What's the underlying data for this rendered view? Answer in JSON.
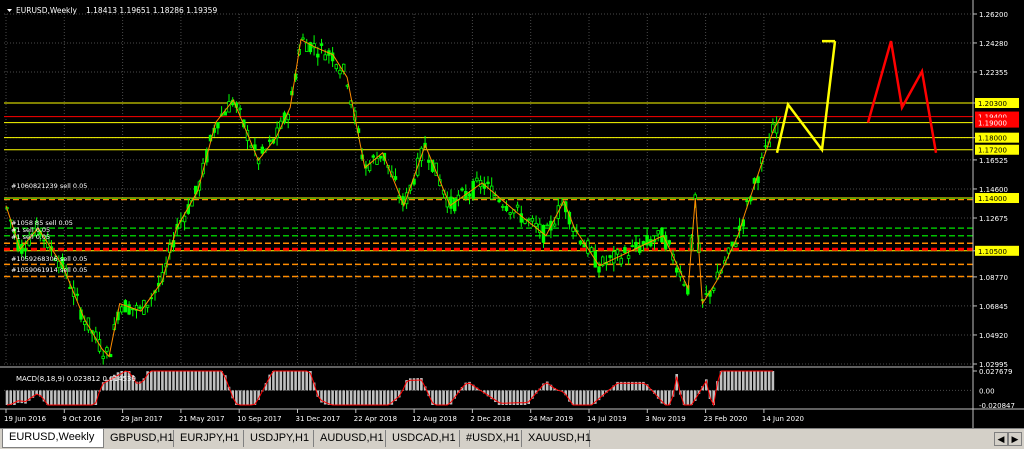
{
  "header": {
    "title": "EURUSD,Weekly",
    "ohlc": "1.18413 1.19651 1.18286 1.19359"
  },
  "price_axis": {
    "ticks": [
      "1.26200",
      "1.24280",
      "1.22355",
      "1.20300",
      "1.18000",
      "1.16525",
      "1.14600",
      "1.12675",
      "1.10500",
      "1.08770",
      "1.06845",
      "1.04920",
      "1.02995"
    ],
    "highlight_labels": [
      {
        "text": "1.20300",
        "bg": "#ffff00",
        "fg": "#000000"
      },
      {
        "text": "1.19400",
        "bg": "#ff0000",
        "fg": "#ffffff"
      },
      {
        "text": "1.19000",
        "bg": "#ff0000",
        "fg": "#ffffff"
      },
      {
        "text": "1.18000",
        "bg": "#ffff00",
        "fg": "#000000"
      },
      {
        "text": "1.17200",
        "bg": "#ffff00",
        "fg": "#000000"
      },
      {
        "text": "1.14000",
        "bg": "#ffff00",
        "fg": "#000000"
      },
      {
        "text": "1.10500",
        "bg": "#ffff00",
        "fg": "#000000"
      }
    ]
  },
  "time_axis": {
    "labels": [
      "19 Jun 2016",
      "9 Oct 2016",
      "29 Jan 2017",
      "21 May 2017",
      "10 Sep 2017",
      "31 Dec 2017",
      "22 Apr 2018",
      "12 Aug 2018",
      "2 Dec 2018",
      "24 Mar 2019",
      "14 Jul 2019",
      "3 Nov 2019",
      "23 Feb 2020",
      "14 Jun 2020"
    ]
  },
  "order_labels": [
    "#1060821239 sell 0.05",
    "#1058 85 sell 0.05",
    "#1 sell 0.05",
    "#1 sell 0.05",
    "#1059268306 sell 0.05",
    "#1059061914 sell 0.05"
  ],
  "macd": {
    "label": "MACD(8,18,9) 0.023812 0.014539",
    "ticks": [
      "0.027679",
      "0.00",
      "-0.020847"
    ]
  },
  "tabs": [
    {
      "label": "EURUSD,Weekly",
      "active": true
    },
    {
      "label": "GBPUSD,H1"
    },
    {
      "label": "EURJPY,H1"
    },
    {
      "label": "USDJPY,H1"
    },
    {
      "label": "AUDUSD,H1"
    },
    {
      "label": "USDCAD,H1"
    },
    {
      "label": "#USDX,H1"
    },
    {
      "label": "XAUUSD,H1"
    }
  ],
  "colors": {
    "background": "#000000",
    "grid": "#4a4a4a",
    "bull_candle": "#00ff00",
    "level_yellow": "#ffff00",
    "level_red": "#ff0000",
    "zigzag": "#ff8c00",
    "projection_bull": "#ffff00",
    "projection_bear": "#ff0000",
    "text": "#ffffff"
  },
  "chart_data": {
    "type": "candlestick",
    "symbol": "EURUSD",
    "timeframe": "Weekly",
    "ylim": [
      1.02995,
      1.262
    ],
    "close_path": [
      [
        "2016-06-19",
        1.135
      ],
      [
        "2016-07-17",
        1.106
      ],
      [
        "2016-08-21",
        1.12
      ],
      [
        "2016-10-09",
        1.095
      ],
      [
        "2016-11-20",
        1.06
      ],
      [
        "2016-12-25",
        1.04
      ],
      [
        "2017-01-08",
        1.035
      ],
      [
        "2017-01-29",
        1.07
      ],
      [
        "2017-03-12",
        1.065
      ],
      [
        "2017-04-23",
        1.085
      ],
      [
        "2017-05-21",
        1.12
      ],
      [
        "2017-07-02",
        1.145
      ],
      [
        "2017-08-06",
        1.19
      ],
      [
        "2017-09-10",
        1.205
      ],
      [
        "2017-10-29",
        1.165
      ],
      [
        "2017-12-03",
        1.18
      ],
      [
        "2017-12-31",
        1.2
      ],
      [
        "2018-01-21",
        1.245
      ],
      [
        "2018-02-18",
        1.24
      ],
      [
        "2018-03-25",
        1.235
      ],
      [
        "2018-04-22",
        1.22
      ],
      [
        "2018-05-27",
        1.16
      ],
      [
        "2018-07-01",
        1.17
      ],
      [
        "2018-08-12",
        1.135
      ],
      [
        "2018-09-23",
        1.175
      ],
      [
        "2018-11-11",
        1.135
      ],
      [
        "2018-12-02",
        1.14
      ],
      [
        "2019-01-13",
        1.15
      ],
      [
        "2019-03-24",
        1.13
      ],
      [
        "2019-05-19",
        1.115
      ],
      [
        "2019-06-23",
        1.138
      ],
      [
        "2019-07-14",
        1.12
      ],
      [
        "2019-09-01",
        1.095
      ],
      [
        "2019-11-03",
        1.105
      ],
      [
        "2020-01-05",
        1.115
      ],
      [
        "2020-02-23",
        1.08
      ],
      [
        "2020-03-08",
        1.14
      ],
      [
        "2020-03-22",
        1.07
      ],
      [
        "2020-04-19",
        1.085
      ],
      [
        "2020-05-31",
        1.115
      ],
      [
        "2020-06-14",
        1.13
      ],
      [
        "2020-07-19",
        1.165
      ],
      [
        "2020-08-09",
        1.185
      ],
      [
        "2020-08-23",
        1.1936
      ]
    ],
    "horizontal_levels": [
      {
        "price": 1.203,
        "color": "yellow",
        "style": "solid"
      },
      {
        "price": 1.194,
        "color": "red",
        "style": "solid"
      },
      {
        "price": 1.19,
        "color": "yellow",
        "style": "solid"
      },
      {
        "price": 1.18,
        "color": "yellow",
        "style": "solid"
      },
      {
        "price": 1.172,
        "color": "yellow",
        "style": "solid"
      },
      {
        "price": 1.14,
        "color": "yellow",
        "style": "solid"
      },
      {
        "price": 1.105,
        "color": "yellow",
        "style": "solid"
      }
    ],
    "order_levels": [
      {
        "price": 1.1395,
        "color": "green",
        "style": "dashed"
      },
      {
        "price": 1.139,
        "color": "orange",
        "style": "dashed"
      },
      {
        "price": 1.12,
        "color": "green",
        "style": "dashed"
      },
      {
        "price": 1.115,
        "color": "green",
        "style": "dashed"
      },
      {
        "price": 1.11,
        "color": "orange",
        "style": "dashed"
      },
      {
        "price": 1.106,
        "color": "red",
        "style": "dashed"
      },
      {
        "price": 1.096,
        "color": "orange",
        "style": "dashed"
      },
      {
        "price": 1.088,
        "color": "orange",
        "style": "dashed"
      }
    ],
    "projection_bullish": [
      [
        1.17,
        1.202
      ],
      [
        1.172,
        1.244
      ],
      [
        1.14
      ]
    ],
    "projection_bearish": [
      [
        1.19,
        1.244
      ],
      [
        1.2,
        1.224
      ],
      [
        1.17
      ]
    ],
    "macd": {
      "fast": 8,
      "slow": 18,
      "signal": 9,
      "value": 0.023812,
      "signal_value": 0.014539,
      "ylim": [
        -0.020847,
        0.027679
      ]
    }
  }
}
